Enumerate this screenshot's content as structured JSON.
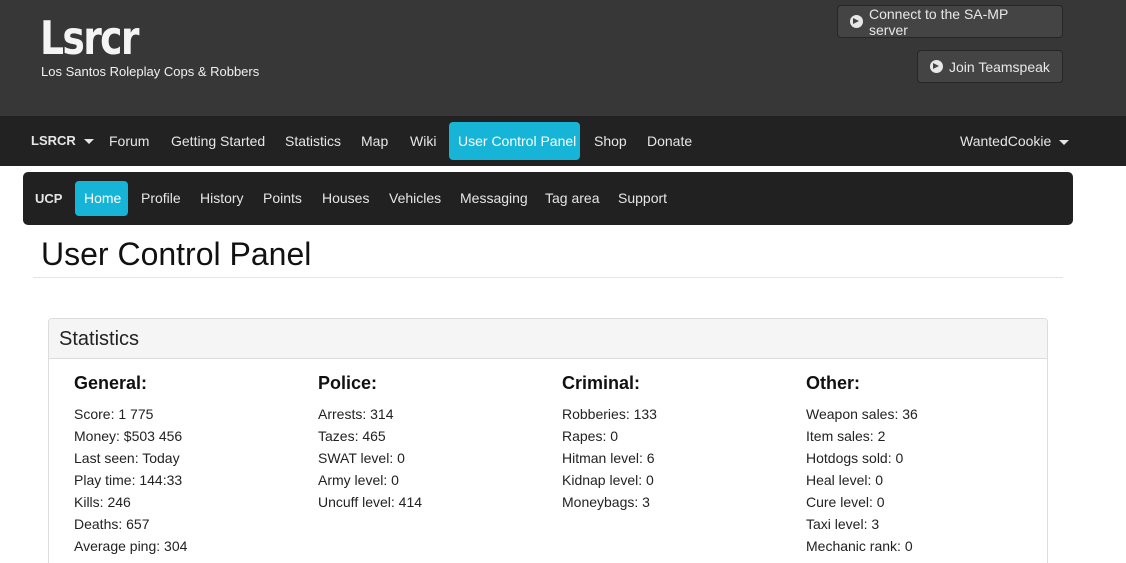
{
  "header": {
    "logo": "Lsrcr",
    "tagline": "Los Santos Roleplay Cops & Robbers",
    "connect_button": "Connect to the SA-MP server",
    "teamspeak_button": "Join Teamspeak"
  },
  "nav": {
    "brand": "LSRCR",
    "items": [
      "Forum",
      "Getting Started",
      "Statistics",
      "Map",
      "Wiki",
      "User Control Panel",
      "Shop",
      "Donate"
    ],
    "active": "User Control Panel",
    "user": "WantedCookie"
  },
  "ucp_nav": {
    "brand": "UCP",
    "items": [
      "Home",
      "Profile",
      "History",
      "Points",
      "Houses",
      "Vehicles",
      "Messaging",
      "Tag area",
      "Support"
    ],
    "active": "Home"
  },
  "page_title": "User Control Panel",
  "panel": {
    "title": "Statistics",
    "columns": [
      {
        "heading": "General:",
        "rows": [
          "Score: 1 775",
          "Money: $503 456",
          "Last seen: Today",
          "Play time: 144:33",
          "Kills: 246",
          "Deaths: 657",
          "Average ping: 304"
        ]
      },
      {
        "heading": "Police:",
        "rows": [
          "Arrests: 314",
          "Tazes: 465",
          "SWAT level: 0",
          "Army level: 0",
          "Uncuff level: 414"
        ]
      },
      {
        "heading": "Criminal:",
        "rows": [
          "Robberies: 133",
          "Rapes: 0",
          "Hitman level: 6",
          "Kidnap level: 0",
          "Moneybags: 3"
        ]
      },
      {
        "heading": "Other:",
        "rows": [
          "Weapon sales: 36",
          "Item sales: 2",
          "Hotdogs sold: 0",
          "Heal level: 0",
          "Cure level: 0",
          "Taxi level: 3",
          "Mechanic rank: 0"
        ]
      }
    ]
  },
  "colors": {
    "header_bg": "#373737",
    "nav_bg": "#222222",
    "accent": "#16b5d8"
  },
  "icons": {
    "header_buttons": "circle-arrow-right-icon",
    "dropdowns": "caret-down-icon"
  }
}
